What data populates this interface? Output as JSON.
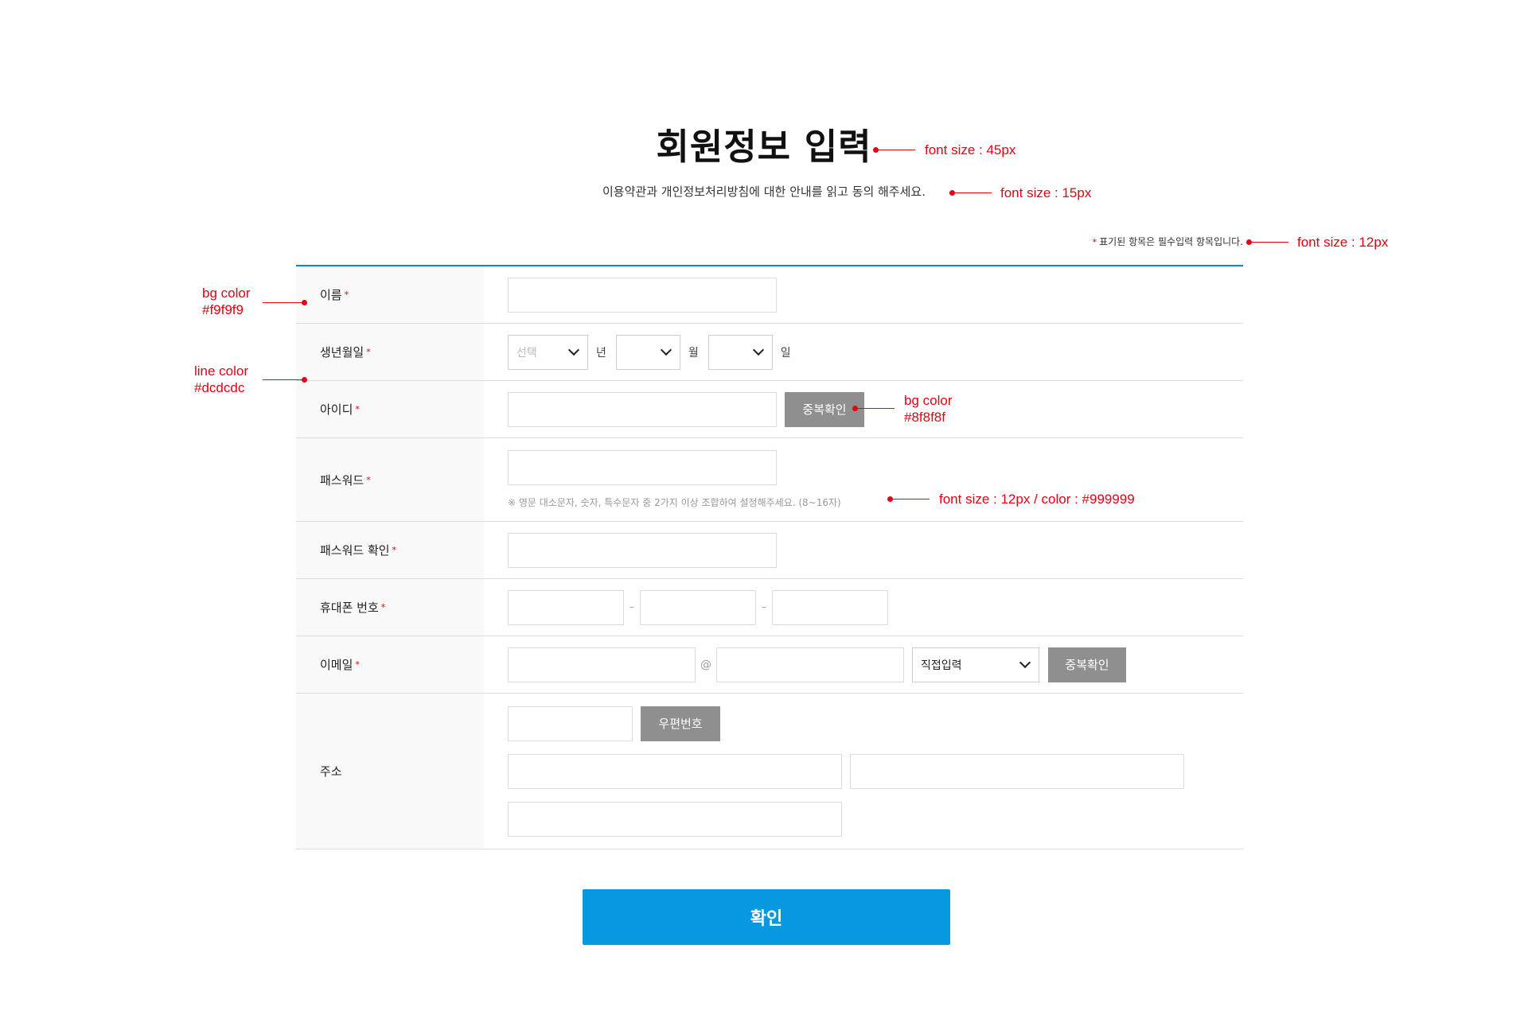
{
  "header": {
    "title": "회원정보 입력",
    "subtitle": "이용약관과 개인정보처리방침에 대한 안내를 읽고 동의 해주세요.",
    "required_star": "*",
    "required_note": "표기된 항목은 필수입력 항목입니다."
  },
  "form": {
    "name": {
      "label": "이름",
      "star": "*",
      "value": ""
    },
    "birth": {
      "label": "생년월일",
      "star": "*",
      "year_select": "선택",
      "year_unit": "년",
      "month_select": "",
      "month_unit": "월",
      "day_select": "",
      "day_unit": "일"
    },
    "user_id": {
      "label": "아이디",
      "star": "*",
      "value": "",
      "check_button": "중복확인"
    },
    "password": {
      "label": "패스워드",
      "star": "*",
      "value": "",
      "hint": "※ 영문 대소문자, 숫자, 특수문자 중 2가지 이상 조합하여 설정해주세요. (8~16자)"
    },
    "password_confirm": {
      "label": "패스워드 확인",
      "star": "*",
      "value": ""
    },
    "phone": {
      "label": "휴대폰 번호",
      "star": "*",
      "part1": "",
      "part2": "",
      "part3": "",
      "separator": "–"
    },
    "email": {
      "label": "이메일",
      "star": "*",
      "local": "",
      "at": "@",
      "domain": "",
      "domain_select": "직접입력",
      "check_button": "중복확인"
    },
    "address": {
      "label": "주소",
      "zipcode": "",
      "zipcode_button": "우편번호",
      "address1": "",
      "address2": "",
      "address3": ""
    }
  },
  "submit_label": "확인",
  "annotations": {
    "title_font": "font size : 45px",
    "subtitle_font": "font size : 15px",
    "note_font": "font size : 12px",
    "label_bg_1": "bg color",
    "label_bg_2": "#f9f9f9",
    "line_color_1": "line color",
    "line_color_2": "#dcdcdc",
    "button_bg_1": "bg color",
    "button_bg_2": "#8f8f8f",
    "hint_font": "font size : 12px / color : #999999"
  },
  "colors": {
    "accent_blue": "#0799e0",
    "top_border": "#1a80d0",
    "label_bg": "#f9f9f9",
    "line": "#dcdcdc",
    "gray_button": "#8f8f8f",
    "hint": "#999999",
    "annotation_red": "#e60012"
  }
}
